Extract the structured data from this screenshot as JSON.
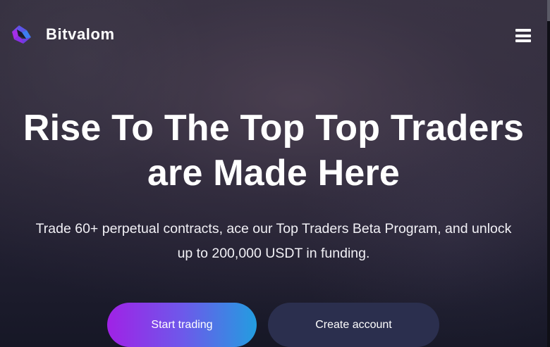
{
  "header": {
    "brand_name": "Bitvalom",
    "logo_icon": "bitvalom-logo-icon",
    "menu_icon": "hamburger-menu-icon"
  },
  "hero": {
    "title_line1": "Rise To The Top Top Traders",
    "title_line2": "are Made Here",
    "subtitle_line1": "Trade 60+ perpetual contracts, ace our Top Traders Beta Program, and unlock",
    "subtitle_line2": "up to 200,000 USDT in funding."
  },
  "actions": {
    "start_trading_label": "Start trading",
    "create_account_label": "Create account"
  },
  "colors": {
    "background": "#2d2a3a",
    "primary_gradient_start": "#a022e6",
    "primary_gradient_end": "#239de0",
    "secondary_button": "#2b2f4e",
    "logo_purple": "#7b3ff2",
    "logo_blue": "#4a6cf7"
  }
}
